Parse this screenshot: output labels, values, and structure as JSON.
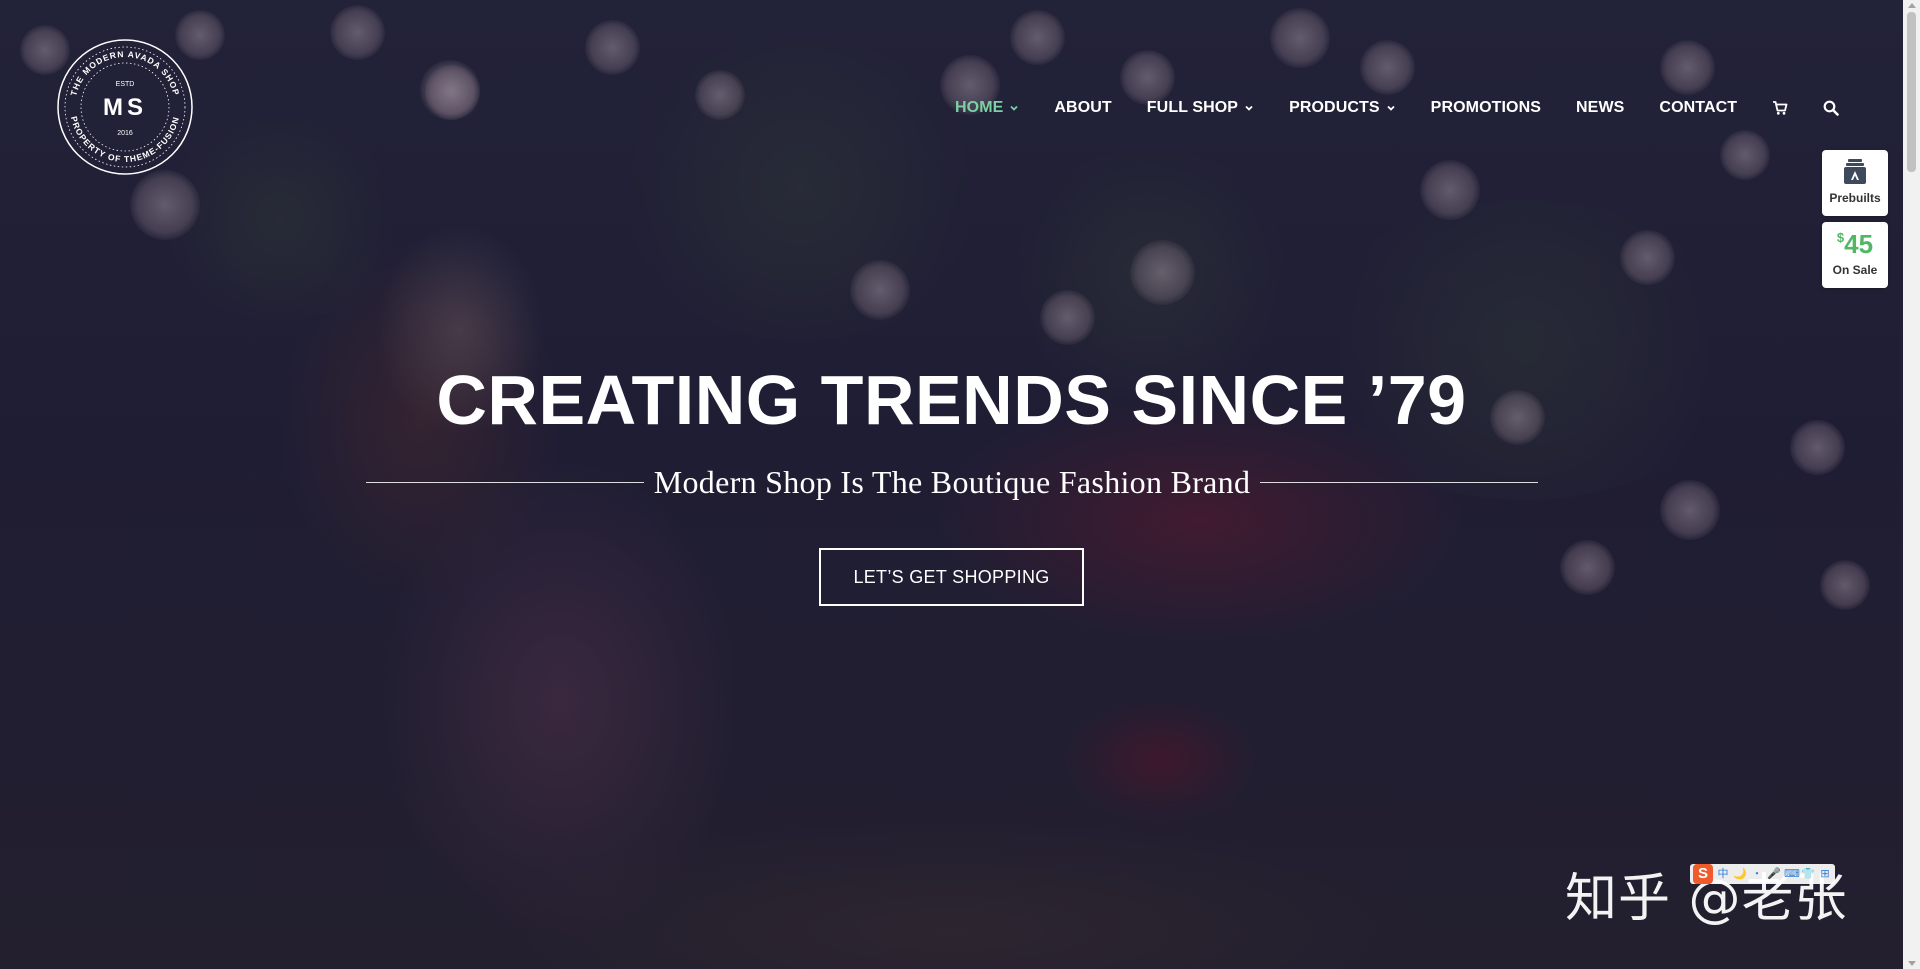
{
  "logo": {
    "ring_text_top": "THE MODERN AVADA SHOP",
    "ring_text_bottom": "PROPERTY OF THEME-FUSION",
    "estd": "ESTD",
    "initials": "MS",
    "year": "2016"
  },
  "nav": {
    "items": [
      {
        "label": "HOME",
        "dropdown": true,
        "active": true
      },
      {
        "label": "ABOUT",
        "dropdown": false
      },
      {
        "label": "FULL SHOP",
        "dropdown": true
      },
      {
        "label": "PRODUCTS",
        "dropdown": true
      },
      {
        "label": "PROMOTIONS",
        "dropdown": false
      },
      {
        "label": "NEWS",
        "dropdown": false
      },
      {
        "label": "CONTACT",
        "dropdown": false
      }
    ],
    "icons": [
      "cart-icon",
      "search-icon"
    ],
    "active_color": "#7bd1a3"
  },
  "side_widgets": {
    "prebuilts_label": "Prebuilts",
    "sale_currency": "$",
    "sale_price": "45",
    "sale_label": "On Sale",
    "price_color": "#52b765"
  },
  "hero": {
    "title": "CREATING TRENDS SINCE ’79",
    "subtitle": "Modern Shop Is The Boutique Fashion Brand",
    "cta_label": "LET’S GET SHOPPING"
  },
  "watermark": {
    "text": "知乎 @老张"
  },
  "ime_toolbar": {
    "logo": "S",
    "items": [
      "中",
      "🌙",
      "・",
      "🎤",
      "⌨",
      "👕",
      "⊞"
    ]
  }
}
